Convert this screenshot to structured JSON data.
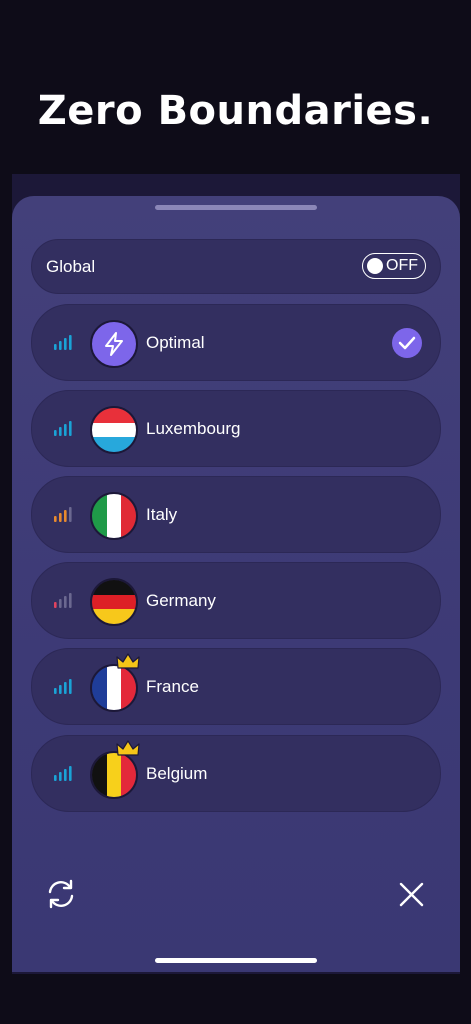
{
  "headline": "Zero Boundaries.",
  "global": {
    "label": "Global",
    "toggle_text": "OFF",
    "toggle_on": false
  },
  "servers": [
    {
      "name": "Optimal",
      "icon": "lightning-icon",
      "signal_bars": 4,
      "signal_color": "#1aa3d6",
      "selected": true,
      "premium": false
    },
    {
      "name": "Luxembourg",
      "icon": "luxembourg-flag-icon",
      "signal_bars": 4,
      "signal_color": "#1aa3d6",
      "selected": false,
      "premium": false
    },
    {
      "name": "Italy",
      "icon": "italy-flag-icon",
      "signal_bars": 3,
      "signal_color": "#e88a2e",
      "selected": false,
      "premium": false
    },
    {
      "name": "Germany",
      "icon": "germany-flag-icon",
      "signal_bars": 1,
      "signal_color": "#e0435f",
      "selected": false,
      "premium": false
    },
    {
      "name": "France",
      "icon": "france-flag-icon",
      "signal_bars": 4,
      "signal_color": "#1aa3d6",
      "selected": false,
      "premium": true
    },
    {
      "name": "Belgium",
      "icon": "belgium-flag-icon",
      "signal_bars": 4,
      "signal_color": "#1aa3d6",
      "selected": false,
      "premium": true
    }
  ],
  "colors": {
    "accent": "#7d66ea",
    "sheet": "#43407a",
    "row": "#332f60",
    "crown": "#f5c518"
  }
}
